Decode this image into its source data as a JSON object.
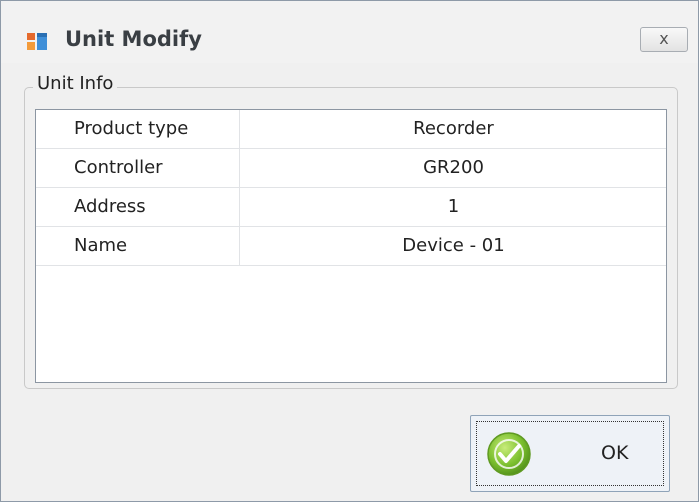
{
  "window": {
    "title": "Unit Modify",
    "close_label": "x"
  },
  "group": {
    "legend": "Unit Info"
  },
  "rows": [
    {
      "key": "Product type",
      "value": "Recorder"
    },
    {
      "key": "Controller",
      "value": "GR200"
    },
    {
      "key": "Address",
      "value": "1"
    },
    {
      "key": "Name",
      "value": "Device - 01"
    }
  ],
  "buttons": {
    "ok_label": "OK"
  },
  "icons": {
    "title": "window-app-icon",
    "ok": "check-icon"
  },
  "colors": {
    "ok_icon_green": "#7bbf2e",
    "title_icon_orange": "#e56a2d",
    "title_icon_blue": "#3f8fd8"
  }
}
